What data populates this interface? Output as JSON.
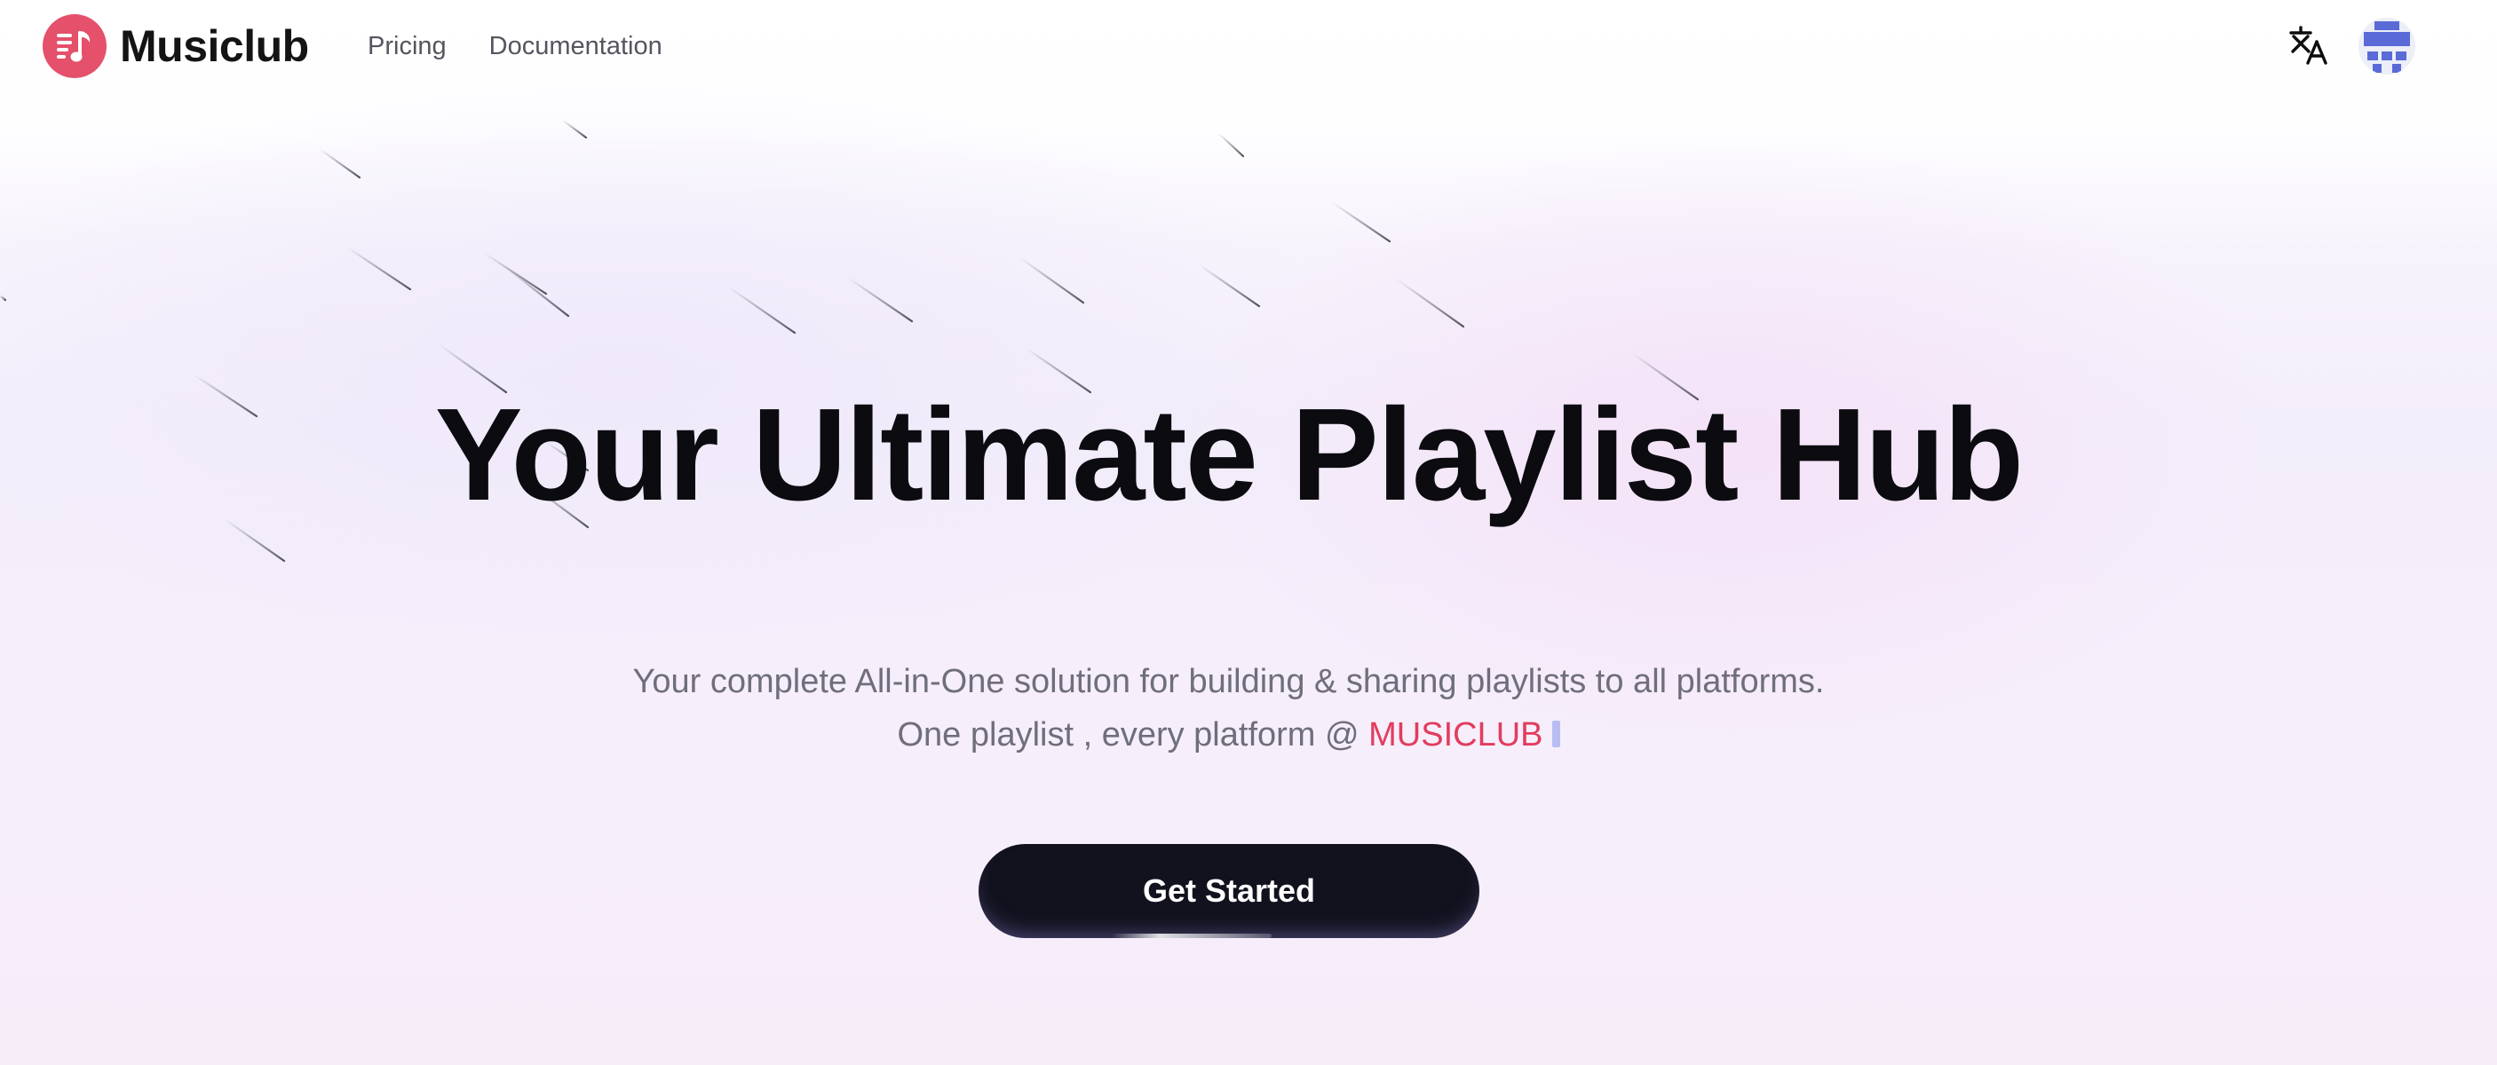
{
  "header": {
    "brand_name": "Musiclub",
    "nav": [
      {
        "label": "Pricing"
      },
      {
        "label": "Documentation"
      }
    ],
    "icons": {
      "logo": "music-note-list-icon",
      "translate": "translate-icon",
      "avatar": "user-avatar"
    }
  },
  "hero": {
    "title": "Your Ultimate Playlist Hub",
    "subtitle_line1": "Your complete All-in-One solution for building & sharing playlists to all platforms.",
    "subtitle_line2_prefix": "One playlist , every platform @ ",
    "subtitle_line2_accent": "MUSICLUB",
    "cta_label": "Get Started"
  },
  "colors": {
    "brand": "#e5506a",
    "accent_text": "#e23c5e",
    "cta_background": "#12121f",
    "avatar_pattern": "#5a6ad6"
  }
}
